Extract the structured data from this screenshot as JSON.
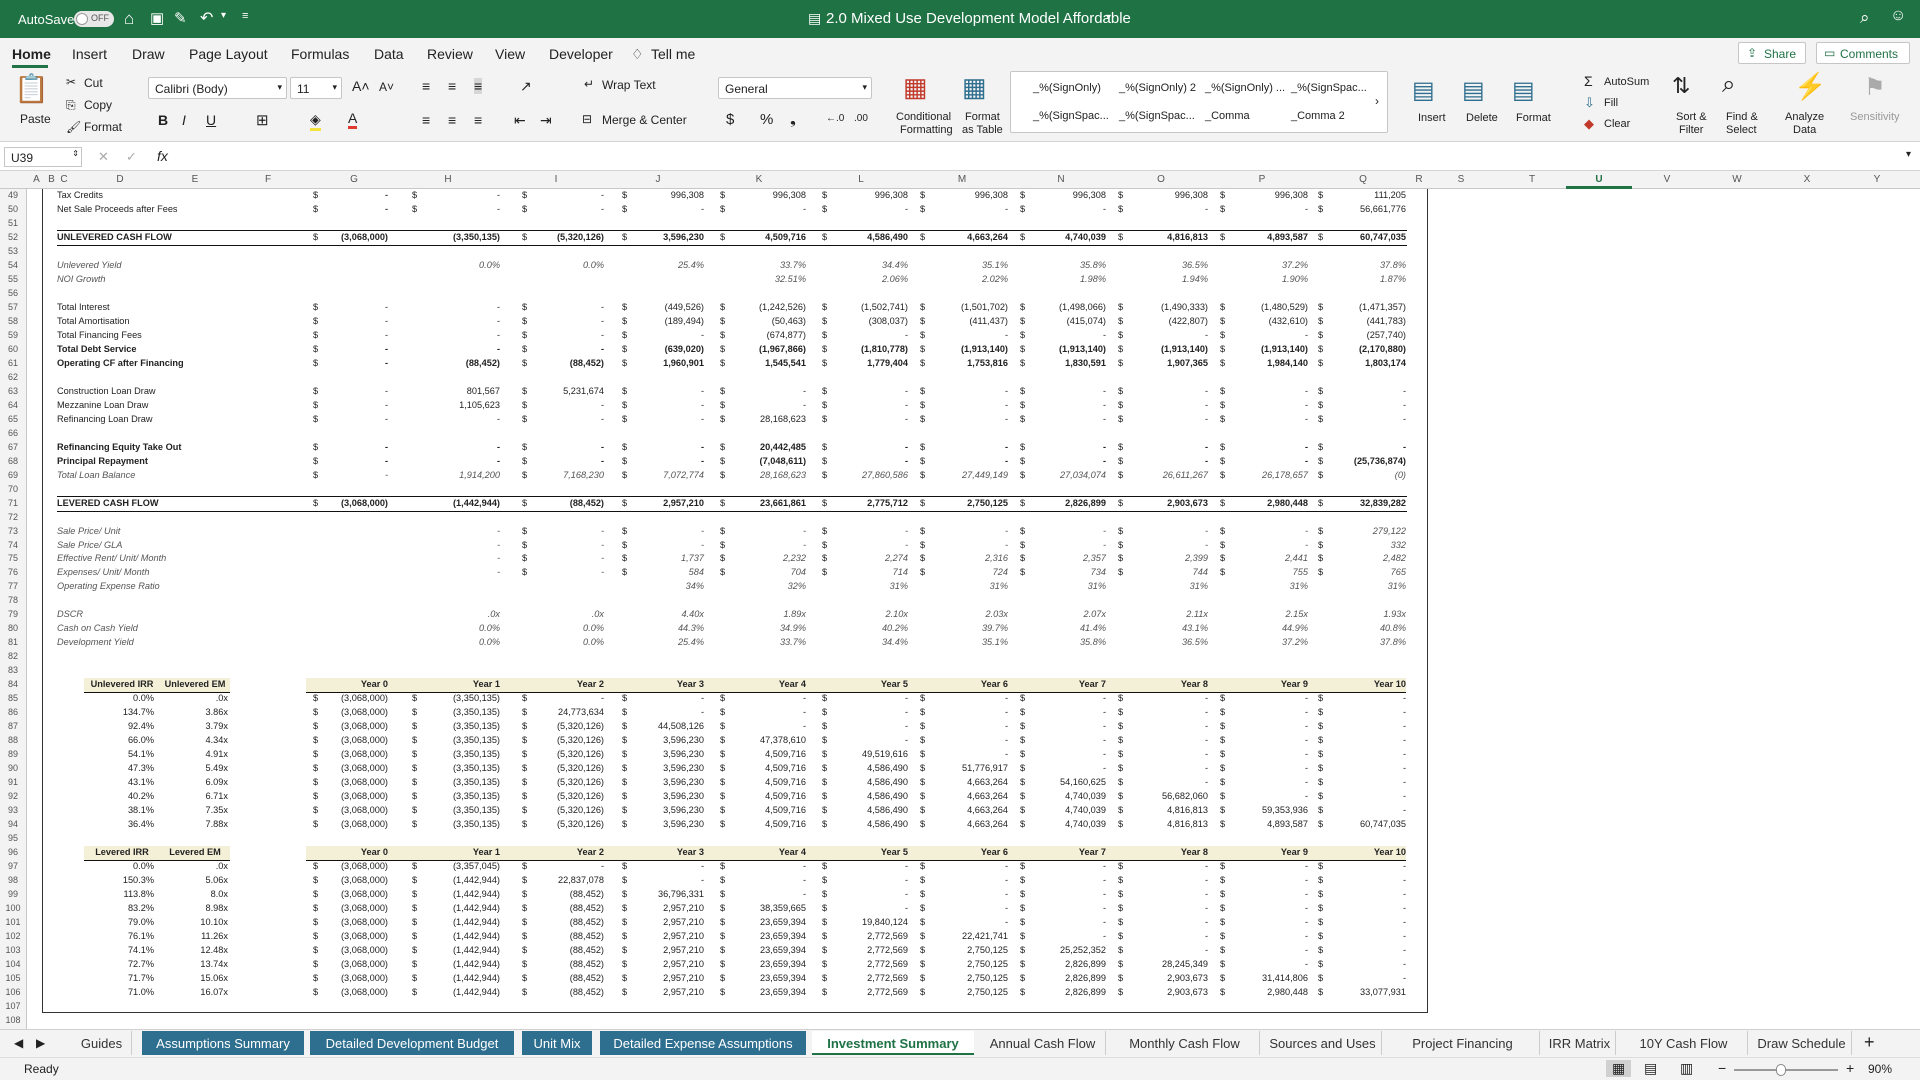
{
  "app": {
    "autosave": "AutoSave",
    "autosave_state": "OFF",
    "title": "2.0 Mixed Use Development Model Affordable"
  },
  "ribbon_tabs": [
    "Home",
    "Insert",
    "Draw",
    "Page Layout",
    "Formulas",
    "Data",
    "Review",
    "View",
    "Developer",
    "Tell me"
  ],
  "share": "Share",
  "comments": "Comments",
  "ribbon": {
    "paste": "Paste",
    "cut": "Cut",
    "copy": "Copy",
    "format": "Format",
    "font": "Calibri (Body)",
    "size": "11",
    "wrap": "Wrap Text",
    "merge": "Merge & Center",
    "numfmt": "General",
    "cond": "Conditional",
    "cond2": "Formatting",
    "fmt_table": "Format",
    "fmt_table2": "as Table",
    "styles": [
      "_%(SignOnly)",
      "_%(SignOnly) 2",
      "_%(SignOnly) ...",
      "_%(SignSpac...",
      "_%(SignSpac...",
      "_%(SignSpac...",
      "_Comma",
      "_Comma 2"
    ],
    "insert": "Insert",
    "delete": "Delete",
    "format2": "Format",
    "autosum": "AutoSum",
    "fill": "Fill",
    "clear": "Clear",
    "sort": "Sort &",
    "sort2": "Filter",
    "find": "Find &",
    "find2": "Select",
    "analyze": "Analyze",
    "analyze2": "Data",
    "sensitivity": "Sensitivity"
  },
  "formula_bar": {
    "namebox": "U39",
    "fx": "fx",
    "content": ""
  },
  "columns": [
    "A",
    "B",
    "C",
    "D",
    "E",
    "F",
    "G",
    "H",
    "I",
    "J",
    "K",
    "L",
    "M",
    "N",
    "O",
    "P",
    "Q",
    "R",
    "S",
    "T",
    "U",
    "V",
    "W",
    "X",
    "Y"
  ],
  "rows": [
    "49",
    "50",
    "51",
    "52",
    "53",
    "54",
    "55",
    "56",
    "57",
    "58",
    "59",
    "60",
    "61",
    "62",
    "63",
    "64",
    "65",
    "66",
    "67",
    "68",
    "69",
    "70",
    "71",
    "72",
    "73",
    "74",
    "75",
    "76",
    "77",
    "78",
    "79",
    "80",
    "81",
    "82",
    "83",
    "84",
    "85",
    "86",
    "87",
    "88",
    "89",
    "90",
    "91",
    "92",
    "93",
    "94",
    "95",
    "96",
    "97",
    "98",
    "99",
    "100",
    "101",
    "102",
    "103",
    "104",
    "105",
    "106",
    "107",
    "108"
  ],
  "sheet": {
    "top": [
      {
        "label": "Tax Credits",
        "style": "",
        "vals": [
          "-",
          "-",
          "-",
          "996,308",
          "996,308",
          "996,308",
          "996,308",
          "996,308",
          "996,308",
          "996,308",
          "111,205"
        ],
        "g": "-"
      },
      {
        "label": "Net Sale Proceeds after Fees",
        "style": "",
        "vals": [
          "-",
          "-",
          "-",
          "-",
          "-",
          "-",
          "-",
          "-",
          "-",
          "-",
          "56,661,776"
        ],
        "g": "-"
      },
      {
        "label": "",
        "style": "",
        "vals": [],
        "g": ""
      },
      {
        "label": "UNLEVERED CASH FLOW",
        "style": "b",
        "vals": [
          "(3,350,135)",
          "(5,320,126)",
          "3,596,230",
          "4,509,716",
          "4,586,490",
          "4,663,264",
          "4,740,039",
          "4,816,813",
          "4,893,587",
          "60,747,035"
        ],
        "g": "(3,068,000)"
      },
      {
        "label": "",
        "style": "",
        "vals": [],
        "g": ""
      },
      {
        "label": "Unlevered Yield",
        "style": "it",
        "vals": [
          "0.0%",
          "0.0%",
          "25.4%",
          "33.7%",
          "34.4%",
          "35.1%",
          "35.8%",
          "36.5%",
          "37.2%",
          "37.8%"
        ],
        "g": "",
        "nodollar": true
      },
      {
        "label": "NOI Growth",
        "style": "it",
        "vals": [
          "",
          "",
          "",
          "32.51%",
          "2.06%",
          "2.02%",
          "1.98%",
          "1.94%",
          "1.90%",
          "1.87%"
        ],
        "g": "",
        "nodollar": true
      },
      {
        "label": "",
        "style": "",
        "vals": [],
        "g": ""
      },
      {
        "label": "Total Interest",
        "style": "",
        "vals": [
          "-",
          "-",
          "(449,526)",
          "(1,242,526)",
          "(1,502,741)",
          "(1,501,702)",
          "(1,498,066)",
          "(1,490,333)",
          "(1,480,529)",
          "(1,471,357)"
        ],
        "g": "-"
      },
      {
        "label": "Total Amortisation",
        "style": "",
        "vals": [
          "-",
          "-",
          "(189,494)",
          "(50,463)",
          "(308,037)",
          "(411,437)",
          "(415,074)",
          "(422,807)",
          "(432,610)",
          "(441,783)"
        ],
        "g": "-"
      },
      {
        "label": "Total Financing Fees",
        "style": "",
        "vals": [
          "-",
          "-",
          "-",
          "(674,877)",
          "-",
          "-",
          "-",
          "-",
          "-",
          "(257,740)"
        ],
        "g": "-"
      },
      {
        "label": "Total Debt Service",
        "style": "b",
        "vals": [
          "-",
          "-",
          "(639,020)",
          "(1,967,866)",
          "(1,810,778)",
          "(1,913,140)",
          "(1,913,140)",
          "(1,913,140)",
          "(1,913,140)",
          "(2,170,880)"
        ],
        "g": "-"
      },
      {
        "label": "Operating CF after Financing",
        "style": "b",
        "vals": [
          "(88,452)",
          "(88,452)",
          "1,960,901",
          "1,545,541",
          "1,779,404",
          "1,753,816",
          "1,830,591",
          "1,907,365",
          "1,984,140",
          "1,803,174"
        ],
        "g": "-"
      },
      {
        "label": "",
        "style": "",
        "vals": [],
        "g": ""
      },
      {
        "label": "Construction Loan Draw",
        "style": "",
        "vals": [
          "801,567",
          "5,231,674",
          "-",
          "-",
          "-",
          "-",
          "-",
          "-",
          "-",
          "-"
        ],
        "g": "-"
      },
      {
        "label": "Mezzanine Loan Draw",
        "style": "",
        "vals": [
          "1,105,623",
          "-",
          "-",
          "-",
          "-",
          "-",
          "-",
          "-",
          "-",
          "-"
        ],
        "g": "-"
      },
      {
        "label": "Refinancing Loan Draw",
        "style": "",
        "vals": [
          "-",
          "-",
          "-",
          "28,168,623",
          "-",
          "-",
          "-",
          "-",
          "-",
          "-"
        ],
        "g": "-"
      },
      {
        "label": "",
        "style": "",
        "vals": [],
        "g": ""
      },
      {
        "label": "Refinancing Equity Take Out",
        "style": "b",
        "vals": [
          "-",
          "-",
          "-",
          "20,442,485",
          "-",
          "-",
          "-",
          "-",
          "-",
          "-"
        ],
        "g": "-"
      },
      {
        "label": "Principal Repayment",
        "style": "b",
        "vals": [
          "-",
          "-",
          "-",
          "(7,048,611)",
          "-",
          "-",
          "-",
          "-",
          "-",
          "(25,736,874)"
        ],
        "g": "-"
      },
      {
        "label": "Total Loan Balance",
        "style": "it",
        "vals": [
          "1,914,200",
          "7,168,230",
          "7,072,774",
          "28,168,623",
          "27,860,586",
          "27,449,149",
          "27,034,074",
          "26,611,267",
          "26,178,657",
          "(0)"
        ],
        "g": "-"
      },
      {
        "label": "",
        "style": "",
        "vals": [],
        "g": ""
      },
      {
        "label": "LEVERED CASH FLOW",
        "style": "b",
        "vals": [
          "(1,442,944)",
          "(88,452)",
          "2,957,210",
          "23,661,861",
          "2,775,712",
          "2,750,125",
          "2,826,899",
          "2,903,673",
          "2,980,448",
          "32,839,282"
        ],
        "g": "(3,068,000)"
      },
      {
        "label": "",
        "style": "",
        "vals": [],
        "g": ""
      },
      {
        "label": "Sale Price/ Unit",
        "style": "it",
        "vals": [
          "-",
          "-",
          "-",
          "-",
          "-",
          "-",
          "-",
          "-",
          "-",
          "279,122"
        ],
        "g": ""
      },
      {
        "label": "Sale Price/ GLA",
        "style": "it",
        "vals": [
          "-",
          "-",
          "-",
          "-",
          "-",
          "-",
          "-",
          "-",
          "-",
          "332"
        ],
        "g": ""
      },
      {
        "label": "Effective Rent/ Unit/ Month",
        "style": "it",
        "vals": [
          "-",
          "-",
          "1,737",
          "2,232",
          "2,274",
          "2,316",
          "2,357",
          "2,399",
          "2,441",
          "2,482"
        ],
        "g": ""
      },
      {
        "label": "Expenses/ Unit/ Month",
        "style": "it",
        "vals": [
          "-",
          "-",
          "584",
          "704",
          "714",
          "724",
          "734",
          "744",
          "755",
          "765"
        ],
        "g": ""
      },
      {
        "label": "Operating Expense Ratio",
        "style": "it",
        "vals": [
          "",
          "",
          "34%",
          "32%",
          "31%",
          "31%",
          "31%",
          "31%",
          "31%",
          "31%"
        ],
        "g": "",
        "nodollar": true
      },
      {
        "label": "",
        "style": "",
        "vals": [],
        "g": ""
      },
      {
        "label": "DSCR",
        "style": "it",
        "vals": [
          ".0x",
          ".0x",
          "4.40x",
          "1.89x",
          "2.10x",
          "2.03x",
          "2.07x",
          "2.11x",
          "2.15x",
          "1.93x"
        ],
        "g": "",
        "nodollar": true
      },
      {
        "label": "Cash on Cash Yield",
        "style": "it",
        "vals": [
          "0.0%",
          "0.0%",
          "44.3%",
          "34.9%",
          "40.2%",
          "39.7%",
          "41.4%",
          "43.1%",
          "44.9%",
          "40.8%"
        ],
        "g": "",
        "nodollar": true
      },
      {
        "label": "Development Yield",
        "style": "it",
        "vals": [
          "0.0%",
          "0.0%",
          "25.4%",
          "33.7%",
          "34.4%",
          "35.1%",
          "35.8%",
          "36.5%",
          "37.2%",
          "37.8%"
        ],
        "g": "",
        "nodollar": true
      }
    ],
    "unlev_hdr": [
      "Unlevered IRR",
      "Unlevered EM"
    ],
    "lev_hdr": [
      "Levered IRR",
      "Levered EM"
    ],
    "years": [
      "Year 0",
      "Year 1",
      "Year 2",
      "Year 3",
      "Year 4",
      "Year 5",
      "Year 6",
      "Year 7",
      "Year 8",
      "Year 9",
      "Year 10"
    ],
    "unlev": [
      [
        "0.0%",
        ".0x",
        [
          "(3,068,000)",
          "(3,350,135)",
          "-",
          "-",
          "-",
          "-",
          "-",
          "-",
          "-",
          "-",
          "-"
        ]
      ],
      [
        "134.7%",
        "3.86x",
        [
          "(3,068,000)",
          "(3,350,135)",
          "24,773,634",
          "-",
          "-",
          "-",
          "-",
          "-",
          "-",
          "-",
          "-"
        ]
      ],
      [
        "92.4%",
        "3.79x",
        [
          "(3,068,000)",
          "(3,350,135)",
          "(5,320,126)",
          "44,508,126",
          "-",
          "-",
          "-",
          "-",
          "-",
          "-",
          "-"
        ]
      ],
      [
        "66.0%",
        "4.34x",
        [
          "(3,068,000)",
          "(3,350,135)",
          "(5,320,126)",
          "3,596,230",
          "47,378,610",
          "-",
          "-",
          "-",
          "-",
          "-",
          "-"
        ]
      ],
      [
        "54.1%",
        "4.91x",
        [
          "(3,068,000)",
          "(3,350,135)",
          "(5,320,126)",
          "3,596,230",
          "4,509,716",
          "49,519,616",
          "-",
          "-",
          "-",
          "-",
          "-"
        ]
      ],
      [
        "47.3%",
        "5.49x",
        [
          "(3,068,000)",
          "(3,350,135)",
          "(5,320,126)",
          "3,596,230",
          "4,509,716",
          "4,586,490",
          "51,776,917",
          "-",
          "-",
          "-",
          "-"
        ]
      ],
      [
        "43.1%",
        "6.09x",
        [
          "(3,068,000)",
          "(3,350,135)",
          "(5,320,126)",
          "3,596,230",
          "4,509,716",
          "4,586,490",
          "4,663,264",
          "54,160,625",
          "-",
          "-",
          "-"
        ]
      ],
      [
        "40.2%",
        "6.71x",
        [
          "(3,068,000)",
          "(3,350,135)",
          "(5,320,126)",
          "3,596,230",
          "4,509,716",
          "4,586,490",
          "4,663,264",
          "4,740,039",
          "56,682,060",
          "-",
          "-"
        ]
      ],
      [
        "38.1%",
        "7.35x",
        [
          "(3,068,000)",
          "(3,350,135)",
          "(5,320,126)",
          "3,596,230",
          "4,509,716",
          "4,586,490",
          "4,663,264",
          "4,740,039",
          "4,816,813",
          "59,353,936",
          "-"
        ]
      ],
      [
        "36.4%",
        "7.88x",
        [
          "(3,068,000)",
          "(3,350,135)",
          "(5,320,126)",
          "3,596,230",
          "4,509,716",
          "4,586,490",
          "4,663,264",
          "4,740,039",
          "4,816,813",
          "4,893,587",
          "60,747,035"
        ]
      ]
    ],
    "lev": [
      [
        "0.0%",
        ".0x",
        [
          "(3,068,000)",
          "(3,357,045)",
          "-",
          "-",
          "-",
          "-",
          "-",
          "-",
          "-",
          "-",
          "-"
        ]
      ],
      [
        "150.3%",
        "5.06x",
        [
          "(3,068,000)",
          "(1,442,944)",
          "22,837,078",
          "-",
          "-",
          "-",
          "-",
          "-",
          "-",
          "-",
          "-"
        ]
      ],
      [
        "113.8%",
        "8.0x",
        [
          "(3,068,000)",
          "(1,442,944)",
          "(88,452)",
          "36,796,331",
          "-",
          "-",
          "-",
          "-",
          "-",
          "-",
          "-"
        ]
      ],
      [
        "83.2%",
        "8.98x",
        [
          "(3,068,000)",
          "(1,442,944)",
          "(88,452)",
          "2,957,210",
          "38,359,665",
          "-",
          "-",
          "-",
          "-",
          "-",
          "-"
        ]
      ],
      [
        "79.0%",
        "10.10x",
        [
          "(3,068,000)",
          "(1,442,944)",
          "(88,452)",
          "2,957,210",
          "23,659,394",
          "19,840,124",
          "-",
          "-",
          "-",
          "-",
          "-"
        ]
      ],
      [
        "76.1%",
        "11.26x",
        [
          "(3,068,000)",
          "(1,442,944)",
          "(88,452)",
          "2,957,210",
          "23,659,394",
          "2,772,569",
          "22,421,741",
          "-",
          "-",
          "-",
          "-"
        ]
      ],
      [
        "74.1%",
        "12.48x",
        [
          "(3,068,000)",
          "(1,442,944)",
          "(88,452)",
          "2,957,210",
          "23,659,394",
          "2,772,569",
          "2,750,125",
          "25,252,352",
          "-",
          "-",
          "-"
        ]
      ],
      [
        "72.7%",
        "13.74x",
        [
          "(3,068,000)",
          "(1,442,944)",
          "(88,452)",
          "2,957,210",
          "23,659,394",
          "2,772,569",
          "2,750,125",
          "2,826,899",
          "28,245,349",
          "-",
          "-"
        ]
      ],
      [
        "71.7%",
        "15.06x",
        [
          "(3,068,000)",
          "(1,442,944)",
          "(88,452)",
          "2,957,210",
          "23,659,394",
          "2,772,569",
          "2,750,125",
          "2,826,899",
          "2,903,673",
          "31,414,806",
          "-"
        ]
      ],
      [
        "71.0%",
        "16.07x",
        [
          "(3,068,000)",
          "(1,442,944)",
          "(88,452)",
          "2,957,210",
          "23,659,394",
          "2,772,569",
          "2,750,125",
          "2,826,899",
          "2,903,673",
          "2,980,448",
          "33,077,931"
        ]
      ]
    ]
  },
  "sheet_tabs": [
    "Guides",
    "Assumptions Summary",
    "Detailed Development Budget",
    "Unit Mix",
    "Detailed Expense Assumptions",
    "Investment Summary",
    "Annual Cash Flow",
    "Monthly Cash Flow",
    "Sources and Uses",
    "Project Financing",
    "IRR Matrix",
    "10Y Cash Flow",
    "Draw Schedule"
  ],
  "status": {
    "ready": "Ready",
    "zoom": "90%"
  },
  "colors": {
    "excel_green": "#1f7244",
    "tab_blue": "#2e6e8e",
    "accent": "#217346"
  }
}
